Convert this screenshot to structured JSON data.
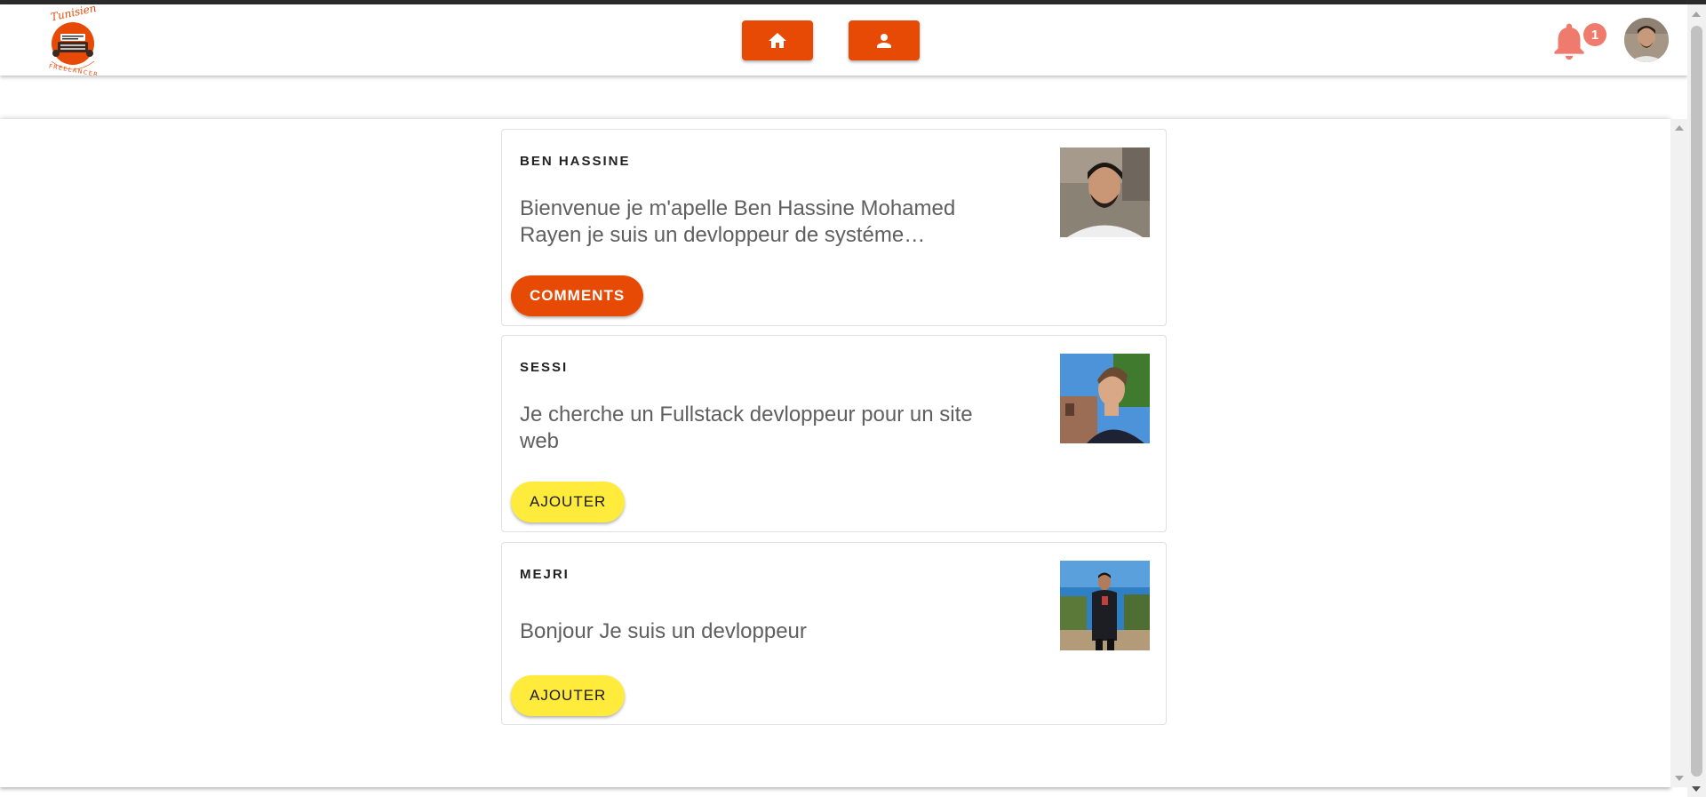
{
  "header": {
    "logo": {
      "name": "tunisien-freelancer-logo",
      "text_top": "Tunisien",
      "text_bottom": "FREELANCER"
    },
    "nav": [
      {
        "icon": "home-icon",
        "color": "#e64a05"
      },
      {
        "icon": "person-icon",
        "color": "#e64a05"
      }
    ],
    "notifications": {
      "icon": "bell-icon",
      "count": "1",
      "badge_color": "#ef7b6e"
    },
    "user": {
      "avatar": "user-avatar"
    }
  },
  "posts": [
    {
      "author": "BEN HASSINE",
      "text": "Bienvenue je m'apelle Ben Hassine Mohamed Rayen je suis un devloppeur de systéme…",
      "button": {
        "label": "COMMENTS",
        "color": "#e64a05"
      },
      "photo": "author-photo"
    },
    {
      "author": "SESSI",
      "text": "Je cherche un Fullstack devloppeur pour un site web",
      "button": {
        "label": "AJOUTER",
        "color": "#ffeb3b"
      },
      "photo": "author-photo"
    },
    {
      "author": "MEJRI",
      "text": "Bonjour Je suis un devloppeur",
      "button": {
        "label": "AJOUTER",
        "color": "#ffeb3b"
      },
      "photo": "author-photo"
    }
  ],
  "theme": {
    "primary": "#e64a05",
    "accent": "#ffeb3b",
    "text_secondary": "#5f5f5f"
  }
}
